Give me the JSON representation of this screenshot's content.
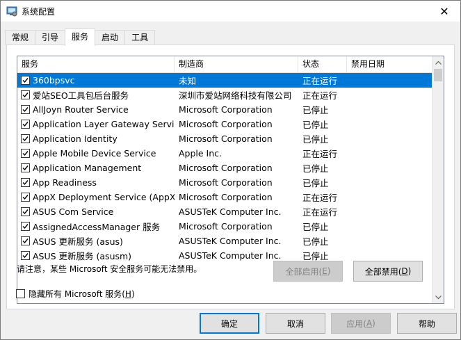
{
  "window": {
    "title": "系统配置",
    "close_glyph": "✕"
  },
  "tabs": [
    {
      "label": "常规",
      "active": false
    },
    {
      "label": "引导",
      "active": false
    },
    {
      "label": "服务",
      "active": true
    },
    {
      "label": "启动",
      "active": false
    },
    {
      "label": "工具",
      "active": false
    }
  ],
  "table": {
    "columns": [
      "服务",
      "制造商",
      "状态",
      "禁用日期"
    ],
    "rows": [
      {
        "checked": true,
        "name": "360bpsvc",
        "maker": "未知",
        "status": "正在运行",
        "disabled_date": "",
        "selected": true
      },
      {
        "checked": true,
        "name": "爱站SEO工具包后台服务",
        "maker": "深圳市爱站网络科技有限公司",
        "status": "正在运行",
        "disabled_date": ""
      },
      {
        "checked": true,
        "name": "AllJoyn Router Service",
        "maker": "Microsoft Corporation",
        "status": "已停止",
        "disabled_date": ""
      },
      {
        "checked": true,
        "name": "Application Layer Gateway Service",
        "maker": "Microsoft Corporation",
        "status": "已停止",
        "disabled_date": ""
      },
      {
        "checked": true,
        "name": "Application Identity",
        "maker": "Microsoft Corporation",
        "status": "已停止",
        "disabled_date": ""
      },
      {
        "checked": true,
        "name": "Apple Mobile Device Service",
        "maker": "Apple Inc.",
        "status": "正在运行",
        "disabled_date": ""
      },
      {
        "checked": true,
        "name": "Application Management",
        "maker": "Microsoft Corporation",
        "status": "已停止",
        "disabled_date": ""
      },
      {
        "checked": true,
        "name": "App Readiness",
        "maker": "Microsoft Corporation",
        "status": "已停止",
        "disabled_date": ""
      },
      {
        "checked": true,
        "name": "AppX Deployment Service (AppX...",
        "maker": "Microsoft Corporation",
        "status": "正在运行",
        "disabled_date": ""
      },
      {
        "checked": true,
        "name": "ASUS Com Service",
        "maker": "ASUSTeK Computer Inc.",
        "status": "正在运行",
        "disabled_date": ""
      },
      {
        "checked": true,
        "name": "AssignedAccessManager 服务",
        "maker": "Microsoft Corporation",
        "status": "已停止",
        "disabled_date": ""
      },
      {
        "checked": true,
        "name": "ASUS 更新服务 (asus)",
        "maker": "ASUSTeK Computer Inc.",
        "status": "已停止",
        "disabled_date": ""
      },
      {
        "checked": true,
        "name": "ASUS 更新服务 (asusm)",
        "maker": "ASUSTeK Computer Inc.",
        "status": "已停止",
        "disabled_date": ""
      }
    ]
  },
  "notice": "请注意，某些 Microsoft 安全服务可能无法禁用。",
  "buttons": {
    "enable_all": {
      "text": "全部启用(",
      "key": "E",
      "tail": ")"
    },
    "disable_all": {
      "text": "全部禁用(",
      "key": "D",
      "tail": ")"
    },
    "ok": "确定",
    "cancel": "取消",
    "apply": {
      "text": "应用(",
      "key": "A",
      "tail": ")"
    },
    "help": "帮助"
  },
  "hide_ms": {
    "text": "隐藏所有 Microsoft 服务(",
    "key": "H",
    "tail": ")",
    "checked": false
  },
  "colors": {
    "selection": "#0078d7",
    "window_bg": "#f0f0f0"
  }
}
